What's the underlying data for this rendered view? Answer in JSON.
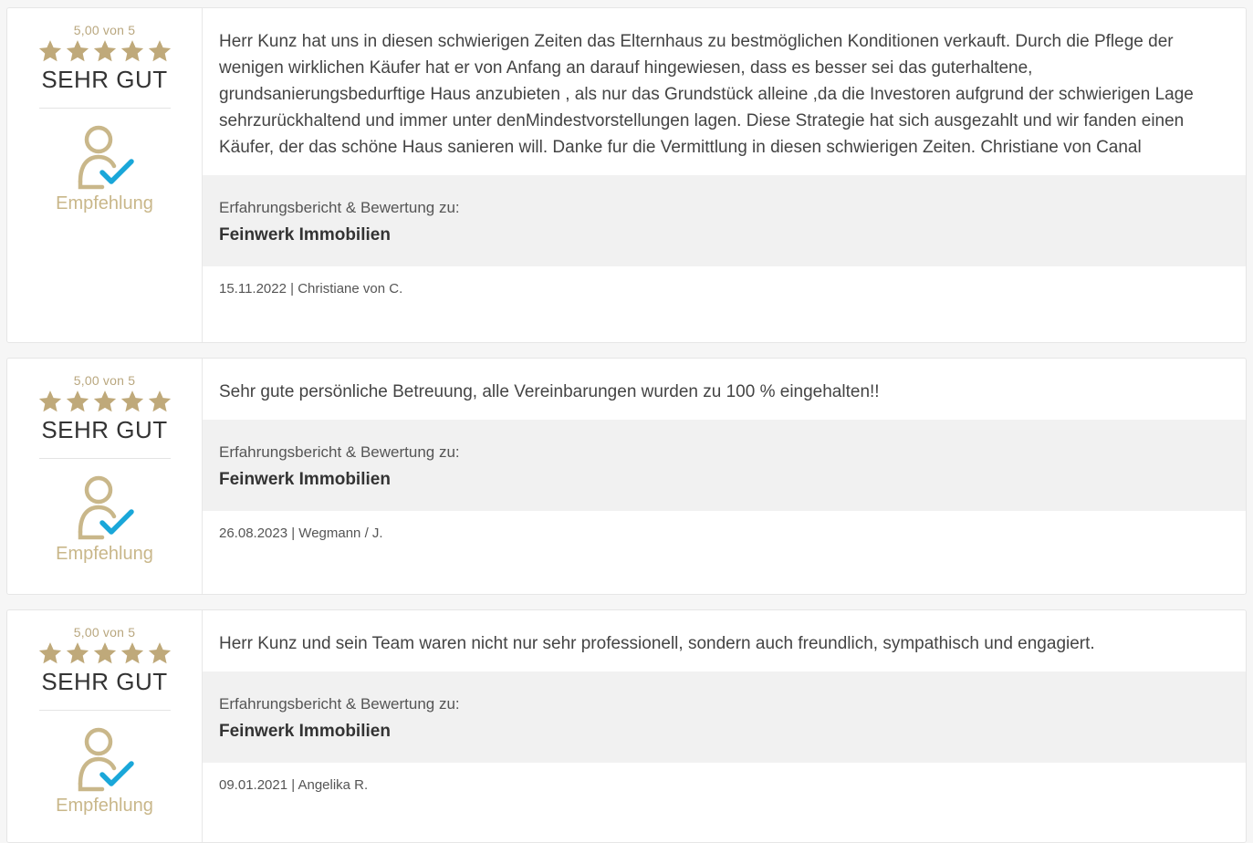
{
  "colors": {
    "accent_gold": "#c9b78a",
    "star_gold": "#bfa97a",
    "check_blue": "#1aa7d9"
  },
  "reviews": [
    {
      "score": "5,00 von 5",
      "stars": 5,
      "verdict": "SEHR GUT",
      "recommendation_icon": "user-check-icon",
      "recommendation": "Empfehlung",
      "text": "Herr Kunz hat uns in diesen schwierigen Zeiten das Elternhaus zu bestmöglichen Konditionen verkauft. Durch die Pflege der wenigen wirklichen Käufer hat er von Anfang an darauf hingewiesen, dass es besser sei das guterhaltene, grundsanierungsbedurftige Haus anzubieten , als nur das Grundstück alleine ,da die Investoren aufgrund der schwierigen Lage sehrzurückhaltend und immer unter denMindestvorstellungen lagen. Diese Strategie hat sich ausgezahlt und wir fanden einen Käufer, der das schöne Haus sanieren will. Danke fur die Vermittlung in diesen schwierigen Zeiten. Christiane von Canal",
      "about_label": "Erfahrungsbericht & Bewertung zu:",
      "company": "Feinwerk Immobilien",
      "meta": "15.11.2022 | Christiane von C."
    },
    {
      "score": "5,00 von 5",
      "stars": 5,
      "verdict": "SEHR GUT",
      "recommendation_icon": "user-check-icon",
      "recommendation": "Empfehlung",
      "text": "Sehr gute persönliche Betreuung, alle Vereinbarungen wurden zu 100 % eingehalten!!",
      "about_label": "Erfahrungsbericht & Bewertung zu:",
      "company": "Feinwerk Immobilien",
      "meta": "26.08.2023 | Wegmann / J."
    },
    {
      "score": "5,00 von 5",
      "stars": 5,
      "verdict": "SEHR GUT",
      "recommendation_icon": "user-check-icon",
      "recommendation": "Empfehlung",
      "text": "Herr Kunz und sein Team waren nicht nur sehr professionell, sondern auch freundlich, sympathisch und engagiert.",
      "about_label": "Erfahrungsbericht & Bewertung zu:",
      "company": "Feinwerk Immobilien",
      "meta": "09.01.2021 | Angelika R."
    }
  ]
}
